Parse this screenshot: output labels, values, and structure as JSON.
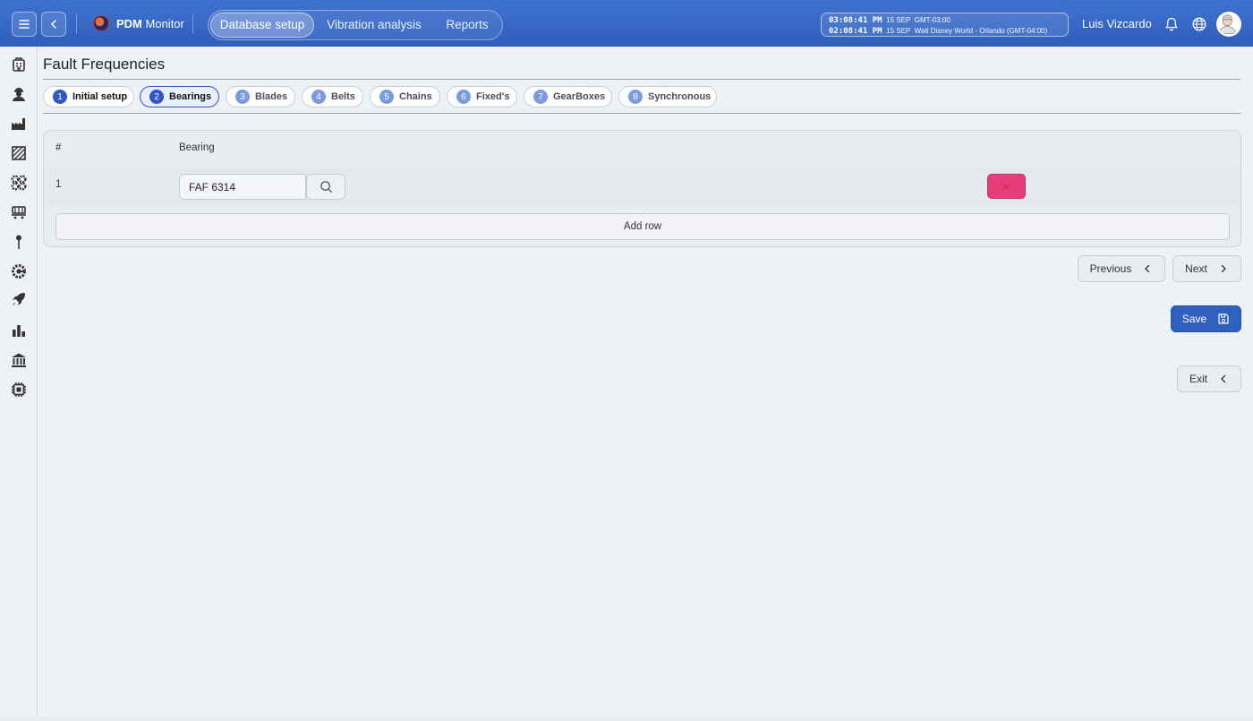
{
  "app": {
    "name_bold": "PDM",
    "name_rest": "Monitor"
  },
  "nav": {
    "tabs": [
      {
        "label": "Database setup",
        "active": true
      },
      {
        "label": "Vibration analysis",
        "active": false
      },
      {
        "label": "Reports",
        "active": false
      }
    ]
  },
  "clock": {
    "line1_time": "03:08:41 PM",
    "line1_date": "15 SEP",
    "line1_zone": "GMT-03:00",
    "line2_time": "02:08:41 PM",
    "line2_date": "15 SEP",
    "line2_zone": "Walt Disney World - Orlando (GMT-04:00)"
  },
  "user": {
    "name": "Luis Vizcardo"
  },
  "sidebar": {
    "icons": [
      "building-icon",
      "worker-icon",
      "factory-icon",
      "hatched-area-icon",
      "gears-icon",
      "conveyor-icon",
      "pin-icon",
      "gear-gauge-icon",
      "rocket-icon",
      "bar-chart-icon",
      "bank-icon",
      "chip-icon"
    ]
  },
  "page": {
    "title": "Fault Frequencies"
  },
  "steps": [
    {
      "num": "1",
      "label": "Initial setup",
      "state": "done"
    },
    {
      "num": "2",
      "label": "Bearings",
      "state": "active"
    },
    {
      "num": "3",
      "label": "Blades",
      "state": "todo"
    },
    {
      "num": "4",
      "label": "Belts",
      "state": "todo"
    },
    {
      "num": "5",
      "label": "Chains",
      "state": "todo"
    },
    {
      "num": "6",
      "label": "Fixed's",
      "state": "todo"
    },
    {
      "num": "7",
      "label": "GearBoxes",
      "state": "todo"
    },
    {
      "num": "8",
      "label": "Synchronous",
      "state": "todo"
    }
  ],
  "table": {
    "headers": {
      "num": "#",
      "bearing": "Bearing"
    },
    "rows": [
      {
        "num": "1",
        "bearing": "FAF 6314"
      }
    ],
    "add_row_label": "Add row"
  },
  "actions": {
    "previous_label": "Previous",
    "next_label": "Next",
    "save_label": "Save",
    "exit_label": "Exit"
  },
  "colors": {
    "topbar": "#2f5fbd",
    "accent": "#2f55c9",
    "delete": "#e53e78",
    "save": "#2f60bd"
  }
}
